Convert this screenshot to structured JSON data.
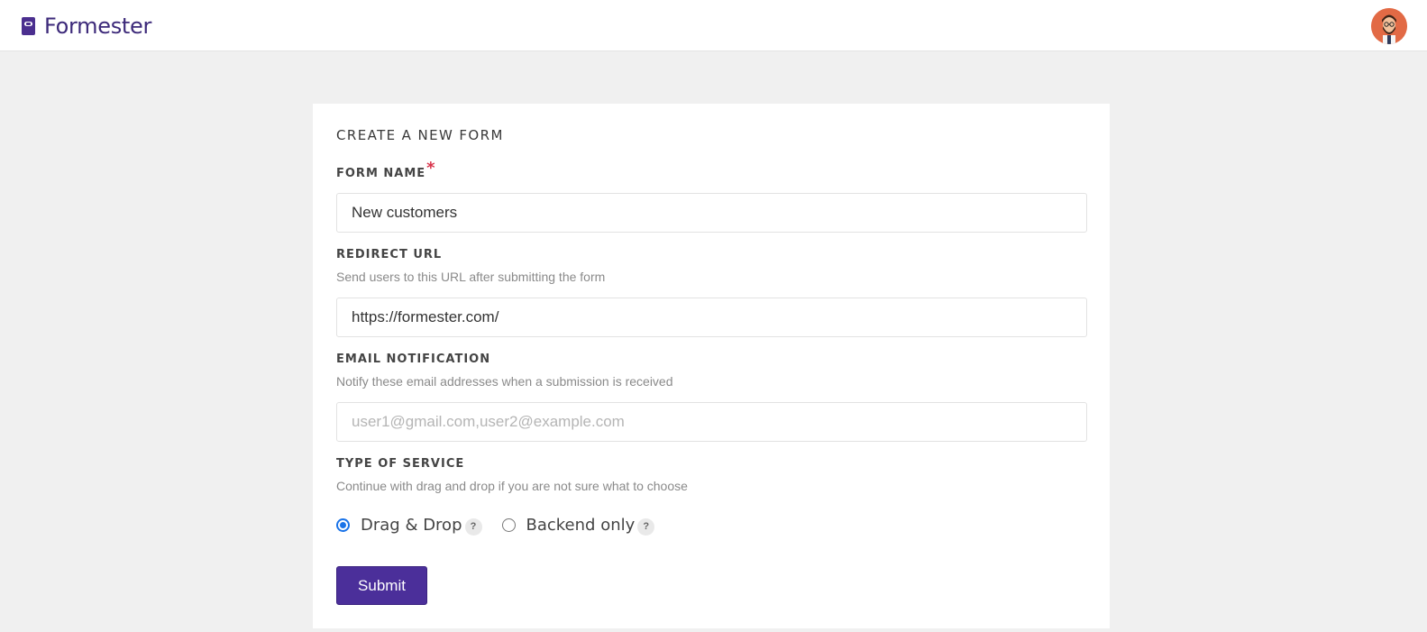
{
  "app": {
    "name": "Formester",
    "brand_color": "#4b2f8f"
  },
  "header": {
    "logo_icon": "formester-logo-icon",
    "avatar_icon": "user-avatar-icon"
  },
  "form": {
    "title": "CREATE A NEW FORM",
    "form_name": {
      "label": "FORM NAME",
      "required_mark": "*",
      "value": "New customers"
    },
    "redirect_url": {
      "label": "REDIRECT URL",
      "help": "Send users to this URL after submitting the form",
      "value": "https://formester.com/"
    },
    "email_notification": {
      "label": "EMAIL NOTIFICATION",
      "help": "Notify these email addresses when a submission is received",
      "value": "",
      "placeholder": "user1@gmail.com,user2@example.com"
    },
    "service_type": {
      "label": "TYPE OF SERVICE",
      "help": "Continue with drag and drop if you are not sure what to choose",
      "options": [
        {
          "label": "Drag & Drop",
          "selected": true,
          "help_icon": "?"
        },
        {
          "label": "Backend only",
          "selected": false,
          "help_icon": "?"
        }
      ]
    },
    "submit_label": "Submit"
  }
}
